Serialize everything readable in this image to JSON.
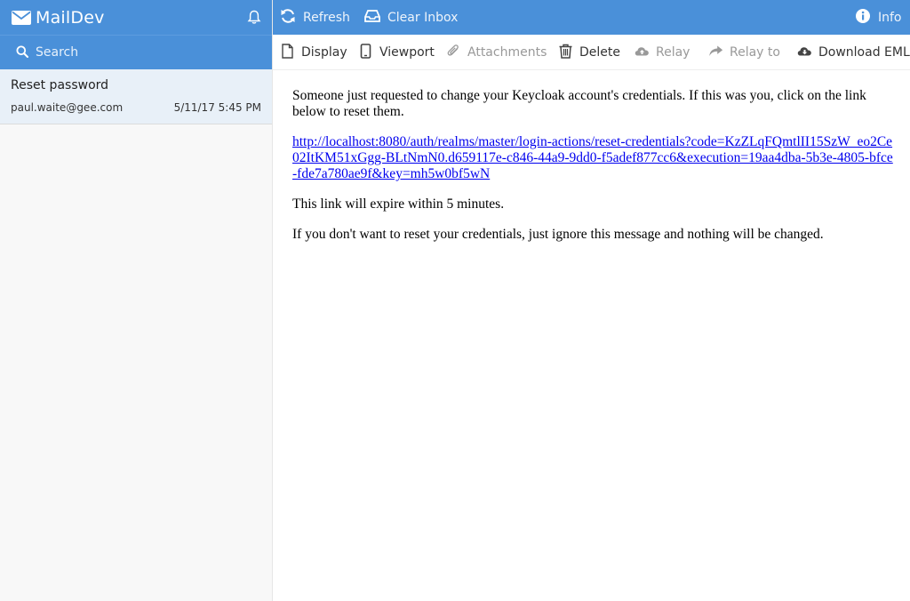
{
  "app": {
    "title": "MailDev"
  },
  "search": {
    "placeholder": "Search"
  },
  "emails": [
    {
      "subject": "Reset password",
      "from": "paul.waite@gee.com",
      "date": "5/11/17 5:45 PM"
    }
  ],
  "topbar": {
    "refresh_label": "Refresh",
    "clear_label": "Clear Inbox",
    "info_label": "Info"
  },
  "toolbar": {
    "display_label": "Display",
    "viewport_label": "Viewport",
    "attachments_label": "Attachments",
    "delete_label": "Delete",
    "relay_label": "Relay",
    "relay_to_label": "Relay to",
    "download_label": "Download EML"
  },
  "message": {
    "intro": "Someone just requested to change your Keycloak account's credentials. If this was you, click on the link below to reset them.",
    "link": "http://localhost:8080/auth/realms/master/login-actions/reset-credentials?code=KzZLqFQmtlII15SzW_eo2Ce02ItKM51xGgg-BLtNmN0.d659117e-c846-44a9-9dd0-f5adef877cc6&execution=19aa4dba-5b3e-4805-bfce-fde7a780ae9f&key=mh5w0bf5wN",
    "expire": "This link will expire within 5 minutes.",
    "ignore": "If you don't want to reset your credentials, just ignore this message and nothing will be changed."
  },
  "colors": {
    "brand": "#4a90d9",
    "selected_row": "#e8f0f8",
    "link": "#0000ee"
  }
}
